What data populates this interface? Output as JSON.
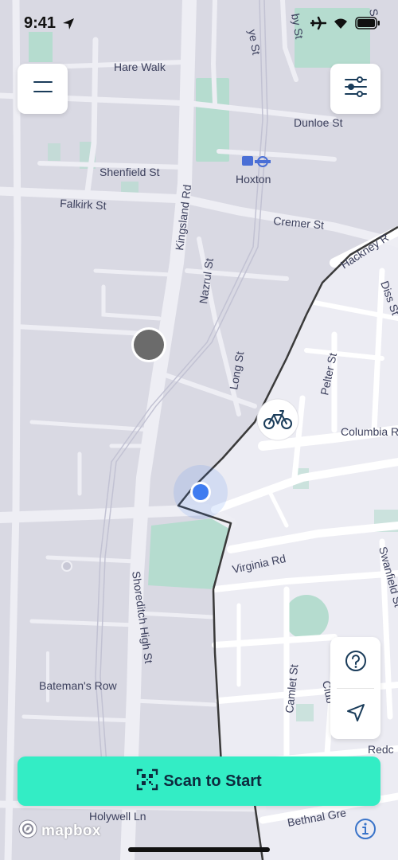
{
  "status_bar": {
    "time": "9:41",
    "icons": [
      "location-arrow-icon",
      "airplane-icon",
      "wifi-icon",
      "battery-icon"
    ]
  },
  "controls": {
    "menu_icon": "hamburger-menu-icon",
    "filter_icon": "sliders-icon",
    "help_icon": "question-icon",
    "locate_icon": "navigation-arrow-icon",
    "info_icon": "info-icon"
  },
  "scan_button": {
    "label": "Scan to Start",
    "icon": "qr-scan-icon"
  },
  "attribution": {
    "logo_text": "mapbox"
  },
  "map": {
    "street_labels": {
      "hare_walk": "Hare Walk",
      "dunloe_st": "Dunloe St",
      "shenfield_st": "Shenfield St",
      "hoxton": "Hoxton",
      "falkirk_st": "Falkirk St",
      "kingsland_rd": "Kingsland Rd",
      "cremer_st": "Cremer St",
      "hackney_rd": "Hackney R",
      "nazrul_st": "Nazrul St",
      "diss_st": "Diss St",
      "pelter_st": "Pelter St",
      "long_st": "Long St",
      "columbia_rd": "Columbia R",
      "virginia_rd": "Virginia Rd",
      "swanfield_st": "Swanfield St",
      "shoreditch_high_st": "Shoreditch High St",
      "camlet_st": "Camlet St",
      "club_row": "Club",
      "bateman_row": "Bateman's Row",
      "redchurch": "Redc",
      "bethnal_green": "Bethnal Gre",
      "holywell_ln": "Holywell Ln",
      "top_fragment_1": "ye St",
      "top_fragment_2": "by St",
      "top_fragment_3": "S"
    },
    "markers": {
      "bike_icon": "bicycle-icon",
      "user_location": "user-location-dot",
      "station": "grey-station-marker"
    },
    "colors": {
      "outside_zone": "#d9d9e3",
      "inside_zone": "#ececf3",
      "road": "#eeeef4",
      "park": "#b5dccf",
      "boundary": "#3a3a3a",
      "user_dot": "#3f7cf0",
      "accent": "#33edc5"
    }
  }
}
